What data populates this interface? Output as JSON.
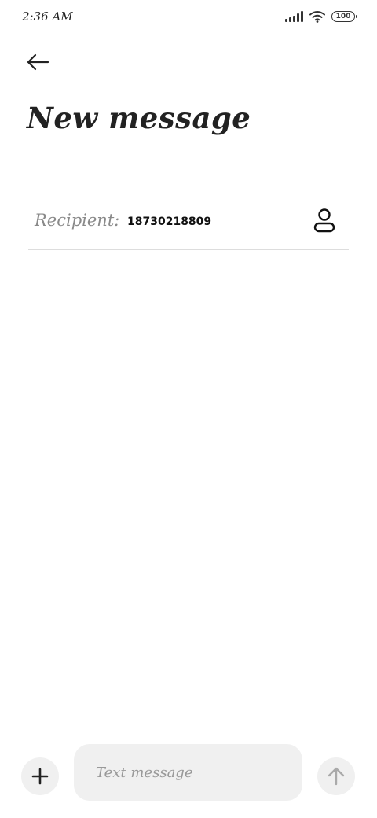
{
  "status_bar": {
    "time": "2:36 AM",
    "battery": "100",
    "icons": [
      "signal-icon",
      "wifi-icon",
      "battery-icon"
    ]
  },
  "header": {
    "back_icon": "arrow-left-icon",
    "title": "New message"
  },
  "recipient": {
    "label": "Recipient:",
    "value": "18730218809",
    "contact_icon": "person-icon"
  },
  "compose": {
    "add_icon": "plus-icon",
    "placeholder": "Text message",
    "value": "",
    "send_icon": "arrow-up-icon"
  },
  "colors": {
    "background": "#ffffff",
    "text": "#222222",
    "muted": "#8a8a8a",
    "input_bg": "#f0f0f0",
    "divider": "#dddddd",
    "send_disabled": "#aaaaaa"
  }
}
